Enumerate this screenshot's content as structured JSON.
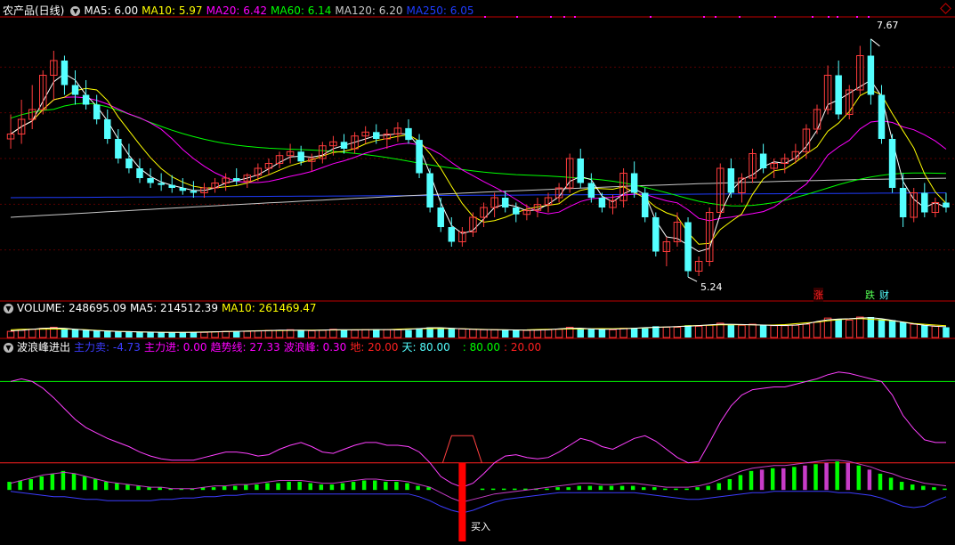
{
  "colors": {
    "up": "#ff3c3c",
    "down": "#54ffff",
    "grid": "#5a0000",
    "frame": "#c00000",
    "ma5": "#ffffff",
    "ma10": "#ffff00",
    "ma20": "#ff00ff",
    "ma60": "#00ff00",
    "ma120": "#c8c8c8",
    "ma250": "#1f3cff",
    "purple": "#c83cc8",
    "blue": "#3c3cff",
    "green": "#00ff00",
    "buy": "#ff0000"
  },
  "main_header": {
    "icon": "chevron-down-icon",
    "title": "农产品(日线)",
    "ma5": "MA5: 6.00",
    "ma10": "MA10: 5.97",
    "ma20": "MA20: 6.42",
    "ma60": "MA60: 6.14",
    "ma120": "MA120: 6.20",
    "ma250": "MA250: 6.05"
  },
  "vol_header": {
    "icon": "chevron-down-icon",
    "volume": "VOLUME: 248695.09",
    "ma5": "MA5: 214512.39",
    "ma10": "MA10: 261469.47"
  },
  "ind_header": {
    "icon": "chevron-down-icon",
    "name": "波浪峰进出",
    "zhuli_sell": "主力卖: -4.73",
    "zhuli_buy": "主力进: 0.00",
    "trend": "趋势线: 27.33",
    "wave": "波浪峰: 0.30",
    "di": "地: 20.00",
    "tian": "天: 80.00",
    "v80": ": 80.00",
    "v20": ": 20.00"
  },
  "annotations": {
    "high_label": "7.67",
    "low_label": "5.24",
    "zhang": "涨",
    "die": "跌",
    "cai": "财",
    "buy": "买入"
  },
  "chart_data": [
    {
      "type": "candlestick",
      "panel": "price",
      "ylim": [
        5.05,
        7.85
      ],
      "grid": true,
      "high": 7.67,
      "low": 5.24,
      "ohlc": [
        [
          6.65,
          6.9,
          6.55,
          6.7
        ],
        [
          6.7,
          7.05,
          6.6,
          6.85
        ],
        [
          6.85,
          7.2,
          6.75,
          6.95
        ],
        [
          6.95,
          7.35,
          6.9,
          7.3
        ],
        [
          7.3,
          7.55,
          7.05,
          7.45
        ],
        [
          7.45,
          7.5,
          7.1,
          7.2
        ],
        [
          7.2,
          7.35,
          7.0,
          7.1
        ],
        [
          7.1,
          7.25,
          6.95,
          7.0
        ],
        [
          7.0,
          7.1,
          6.8,
          6.85
        ],
        [
          6.85,
          6.95,
          6.6,
          6.65
        ],
        [
          6.65,
          6.75,
          6.4,
          6.45
        ],
        [
          6.45,
          6.6,
          6.3,
          6.35
        ],
        [
          6.35,
          6.45,
          6.2,
          6.25
        ],
        [
          6.25,
          6.35,
          6.15,
          6.2
        ],
        [
          6.2,
          6.3,
          6.12,
          6.18
        ],
        [
          6.18,
          6.28,
          6.1,
          6.15
        ],
        [
          6.15,
          6.25,
          6.08,
          6.12
        ],
        [
          6.12,
          6.22,
          6.05,
          6.1
        ],
        [
          6.1,
          6.2,
          6.05,
          6.15
        ],
        [
          6.15,
          6.25,
          6.1,
          6.2
        ],
        [
          6.2,
          6.3,
          6.12,
          6.25
        ],
        [
          6.25,
          6.35,
          6.18,
          6.22
        ],
        [
          6.22,
          6.3,
          6.15,
          6.28
        ],
        [
          6.28,
          6.4,
          6.22,
          6.35
        ],
        [
          6.35,
          6.45,
          6.28,
          6.4
        ],
        [
          6.4,
          6.52,
          6.35,
          6.48
        ],
        [
          6.48,
          6.6,
          6.4,
          6.52
        ],
        [
          6.52,
          6.58,
          6.38,
          6.42
        ],
        [
          6.42,
          6.5,
          6.32,
          6.45
        ],
        [
          6.45,
          6.62,
          6.4,
          6.58
        ],
        [
          6.58,
          6.68,
          6.48,
          6.62
        ],
        [
          6.62,
          6.7,
          6.5,
          6.55
        ],
        [
          6.55,
          6.72,
          6.5,
          6.68
        ],
        [
          6.68,
          6.78,
          6.6,
          6.72
        ],
        [
          6.72,
          6.8,
          6.6,
          6.65
        ],
        [
          6.65,
          6.75,
          6.55,
          6.7
        ],
        [
          6.7,
          6.82,
          6.62,
          6.76
        ],
        [
          6.76,
          6.85,
          6.6,
          6.64
        ],
        [
          6.64,
          6.7,
          6.25,
          6.3
        ],
        [
          6.3,
          6.35,
          5.9,
          5.95
        ],
        [
          5.95,
          6.05,
          5.7,
          5.75
        ],
        [
          5.75,
          5.85,
          5.55,
          5.6
        ],
        [
          5.6,
          5.75,
          5.55,
          5.7
        ],
        [
          5.7,
          5.9,
          5.65,
          5.85
        ],
        [
          5.85,
          6.0,
          5.75,
          5.95
        ],
        [
          5.95,
          6.1,
          5.85,
          6.05
        ],
        [
          6.05,
          6.12,
          5.9,
          5.95
        ],
        [
          5.95,
          6.0,
          5.8,
          5.88
        ],
        [
          5.88,
          5.98,
          5.82,
          5.92
        ],
        [
          5.92,
          6.05,
          5.85,
          5.98
        ],
        [
          5.98,
          6.1,
          5.9,
          6.05
        ],
        [
          6.05,
          6.2,
          6.0,
          6.15
        ],
        [
          6.15,
          6.5,
          6.1,
          6.45
        ],
        [
          6.45,
          6.55,
          6.15,
          6.2
        ],
        [
          6.2,
          6.3,
          6.0,
          6.05
        ],
        [
          6.05,
          6.1,
          5.9,
          5.95
        ],
        [
          5.95,
          6.08,
          5.88,
          6.02
        ],
        [
          6.02,
          6.35,
          5.95,
          6.3
        ],
        [
          6.3,
          6.42,
          6.05,
          6.1
        ],
        [
          6.1,
          6.15,
          5.8,
          5.85
        ],
        [
          5.85,
          5.9,
          5.45,
          5.5
        ],
        [
          5.5,
          5.65,
          5.35,
          5.6
        ],
        [
          5.6,
          5.9,
          5.55,
          5.8
        ],
        [
          5.8,
          5.85,
          5.24,
          5.3
        ],
        [
          5.3,
          5.45,
          5.25,
          5.4
        ],
        [
          5.4,
          5.95,
          5.35,
          5.9
        ],
        [
          5.9,
          6.4,
          5.85,
          6.35
        ],
        [
          6.35,
          6.45,
          6.05,
          6.1
        ],
        [
          6.1,
          6.3,
          6.0,
          6.25
        ],
        [
          6.25,
          6.55,
          6.2,
          6.5
        ],
        [
          6.5,
          6.6,
          6.3,
          6.35
        ],
        [
          6.35,
          6.45,
          6.25,
          6.4
        ],
        [
          6.4,
          6.5,
          6.3,
          6.45
        ],
        [
          6.45,
          6.6,
          6.4,
          6.52
        ],
        [
          6.52,
          6.8,
          6.45,
          6.75
        ],
        [
          6.75,
          7.0,
          6.7,
          6.95
        ],
        [
          6.95,
          7.4,
          6.9,
          7.3
        ],
        [
          7.3,
          7.45,
          6.85,
          6.9
        ],
        [
          6.9,
          7.2,
          6.85,
          7.15
        ],
        [
          7.15,
          7.6,
          7.1,
          7.5
        ],
        [
          7.5,
          7.67,
          7.0,
          7.1
        ],
        [
          7.1,
          7.2,
          6.6,
          6.65
        ],
        [
          6.65,
          6.7,
          6.1,
          6.15
        ],
        [
          6.15,
          6.3,
          5.75,
          5.85
        ],
        [
          5.85,
          6.15,
          5.8,
          6.1
        ],
        [
          6.1,
          6.2,
          5.85,
          5.9
        ],
        [
          5.9,
          6.05,
          5.85,
          6.0
        ],
        [
          6.0,
          6.1,
          5.9,
          5.95
        ]
      ]
    },
    {
      "type": "bar",
      "panel": "volume",
      "grid": false,
      "values": [
        0.3,
        0.35,
        0.4,
        0.45,
        0.5,
        0.45,
        0.4,
        0.35,
        0.35,
        0.3,
        0.3,
        0.28,
        0.28,
        0.25,
        0.25,
        0.25,
        0.25,
        0.25,
        0.25,
        0.28,
        0.3,
        0.3,
        0.3,
        0.32,
        0.35,
        0.35,
        0.38,
        0.35,
        0.33,
        0.35,
        0.4,
        0.38,
        0.36,
        0.38,
        0.4,
        0.38,
        0.38,
        0.36,
        0.45,
        0.5,
        0.48,
        0.45,
        0.42,
        0.4,
        0.38,
        0.38,
        0.38,
        0.36,
        0.35,
        0.36,
        0.38,
        0.4,
        0.5,
        0.45,
        0.42,
        0.4,
        0.38,
        0.45,
        0.45,
        0.45,
        0.55,
        0.5,
        0.5,
        0.6,
        0.55,
        0.6,
        0.7,
        0.65,
        0.6,
        0.65,
        0.6,
        0.58,
        0.58,
        0.6,
        0.65,
        0.75,
        0.95,
        0.9,
        0.85,
        1.0,
        1.0,
        0.9,
        0.85,
        0.75,
        0.65,
        0.6,
        0.55,
        0.5
      ]
    },
    {
      "type": "line",
      "panel": "indicator",
      "ylim": [
        -38,
        100
      ],
      "lines": {
        "tian": 80,
        "di": 20
      },
      "trend": [
        80,
        82,
        80,
        75,
        68,
        60,
        52,
        46,
        42,
        38,
        35,
        32,
        28,
        25,
        23,
        22,
        22,
        22,
        24,
        26,
        28,
        28,
        27,
        25,
        26,
        30,
        33,
        35,
        32,
        28,
        27,
        30,
        33,
        35,
        35,
        33,
        33,
        32,
        28,
        20,
        10,
        5,
        2,
        5,
        12,
        20,
        25,
        26,
        24,
        23,
        24,
        28,
        33,
        38,
        36,
        32,
        30,
        34,
        38,
        40,
        36,
        30,
        24,
        20,
        21,
        35,
        50,
        62,
        70,
        74,
        75,
        76,
        76,
        78,
        80,
        82,
        85,
        87,
        86,
        84,
        82,
        80,
        70,
        55,
        45,
        37,
        35,
        35
      ],
      "wave": [
        5,
        7,
        9,
        11,
        12,
        13,
        12,
        10,
        8,
        6,
        5,
        4,
        3,
        2,
        2,
        1,
        1,
        1,
        2,
        3,
        3,
        4,
        4,
        5,
        6,
        7,
        7,
        7,
        6,
        5,
        5,
        6,
        7,
        8,
        8,
        7,
        7,
        6,
        4,
        2,
        -2,
        -6,
        -9,
        -7,
        -5,
        -3,
        -2,
        -1,
        0,
        1,
        2,
        3,
        4,
        5,
        5,
        4,
        4,
        5,
        5,
        4,
        3,
        2,
        2,
        2,
        3,
        5,
        8,
        11,
        14,
        16,
        17,
        18,
        18,
        19,
        20,
        21,
        22,
        22,
        21,
        19,
        17,
        14,
        12,
        9,
        7,
        5,
        4,
        3
      ],
      "zhuli_sell": [
        -1,
        -2,
        -3,
        -4,
        -5,
        -5,
        -6,
        -7,
        -7,
        -8,
        -8,
        -8,
        -8,
        -8,
        -7,
        -7,
        -6,
        -6,
        -5,
        -5,
        -4,
        -4,
        -3,
        -3,
        -3,
        -3,
        -3,
        -3,
        -3,
        -3,
        -3,
        -3,
        -3,
        -3,
        -3,
        -3,
        -3,
        -3,
        -5,
        -8,
        -12,
        -15,
        -17,
        -15,
        -12,
        -9,
        -7,
        -6,
        -5,
        -4,
        -3,
        -2,
        -2,
        -2,
        -2,
        -2,
        -2,
        -2,
        -2,
        -3,
        -4,
        -5,
        -6,
        -7,
        -7,
        -6,
        -5,
        -4,
        -3,
        -2,
        -2,
        -1,
        -1,
        -1,
        -1,
        -1,
        -1,
        -2,
        -2,
        -3,
        -4,
        -6,
        -9,
        -12,
        -13,
        -12,
        -8,
        -5
      ],
      "bars": [
        6,
        7,
        8,
        10,
        12,
        14,
        12,
        10,
        8,
        6,
        5,
        4,
        3,
        2,
        2,
        1,
        1,
        1,
        2,
        2,
        3,
        3,
        4,
        4,
        5,
        5,
        6,
        6,
        5,
        4,
        4,
        5,
        6,
        7,
        7,
        6,
        6,
        5,
        3,
        2,
        0,
        0,
        0,
        0,
        1,
        1,
        1,
        1,
        1,
        1,
        1,
        2,
        2,
        3,
        3,
        3,
        3,
        3,
        3,
        2,
        2,
        1,
        1,
        1,
        2,
        3,
        5,
        8,
        11,
        14,
        15,
        16,
        16,
        17,
        18,
        19,
        20,
        21,
        20,
        18,
        15,
        12,
        9,
        6,
        4,
        3,
        2,
        1
      ],
      "buy_index": 42
    }
  ]
}
